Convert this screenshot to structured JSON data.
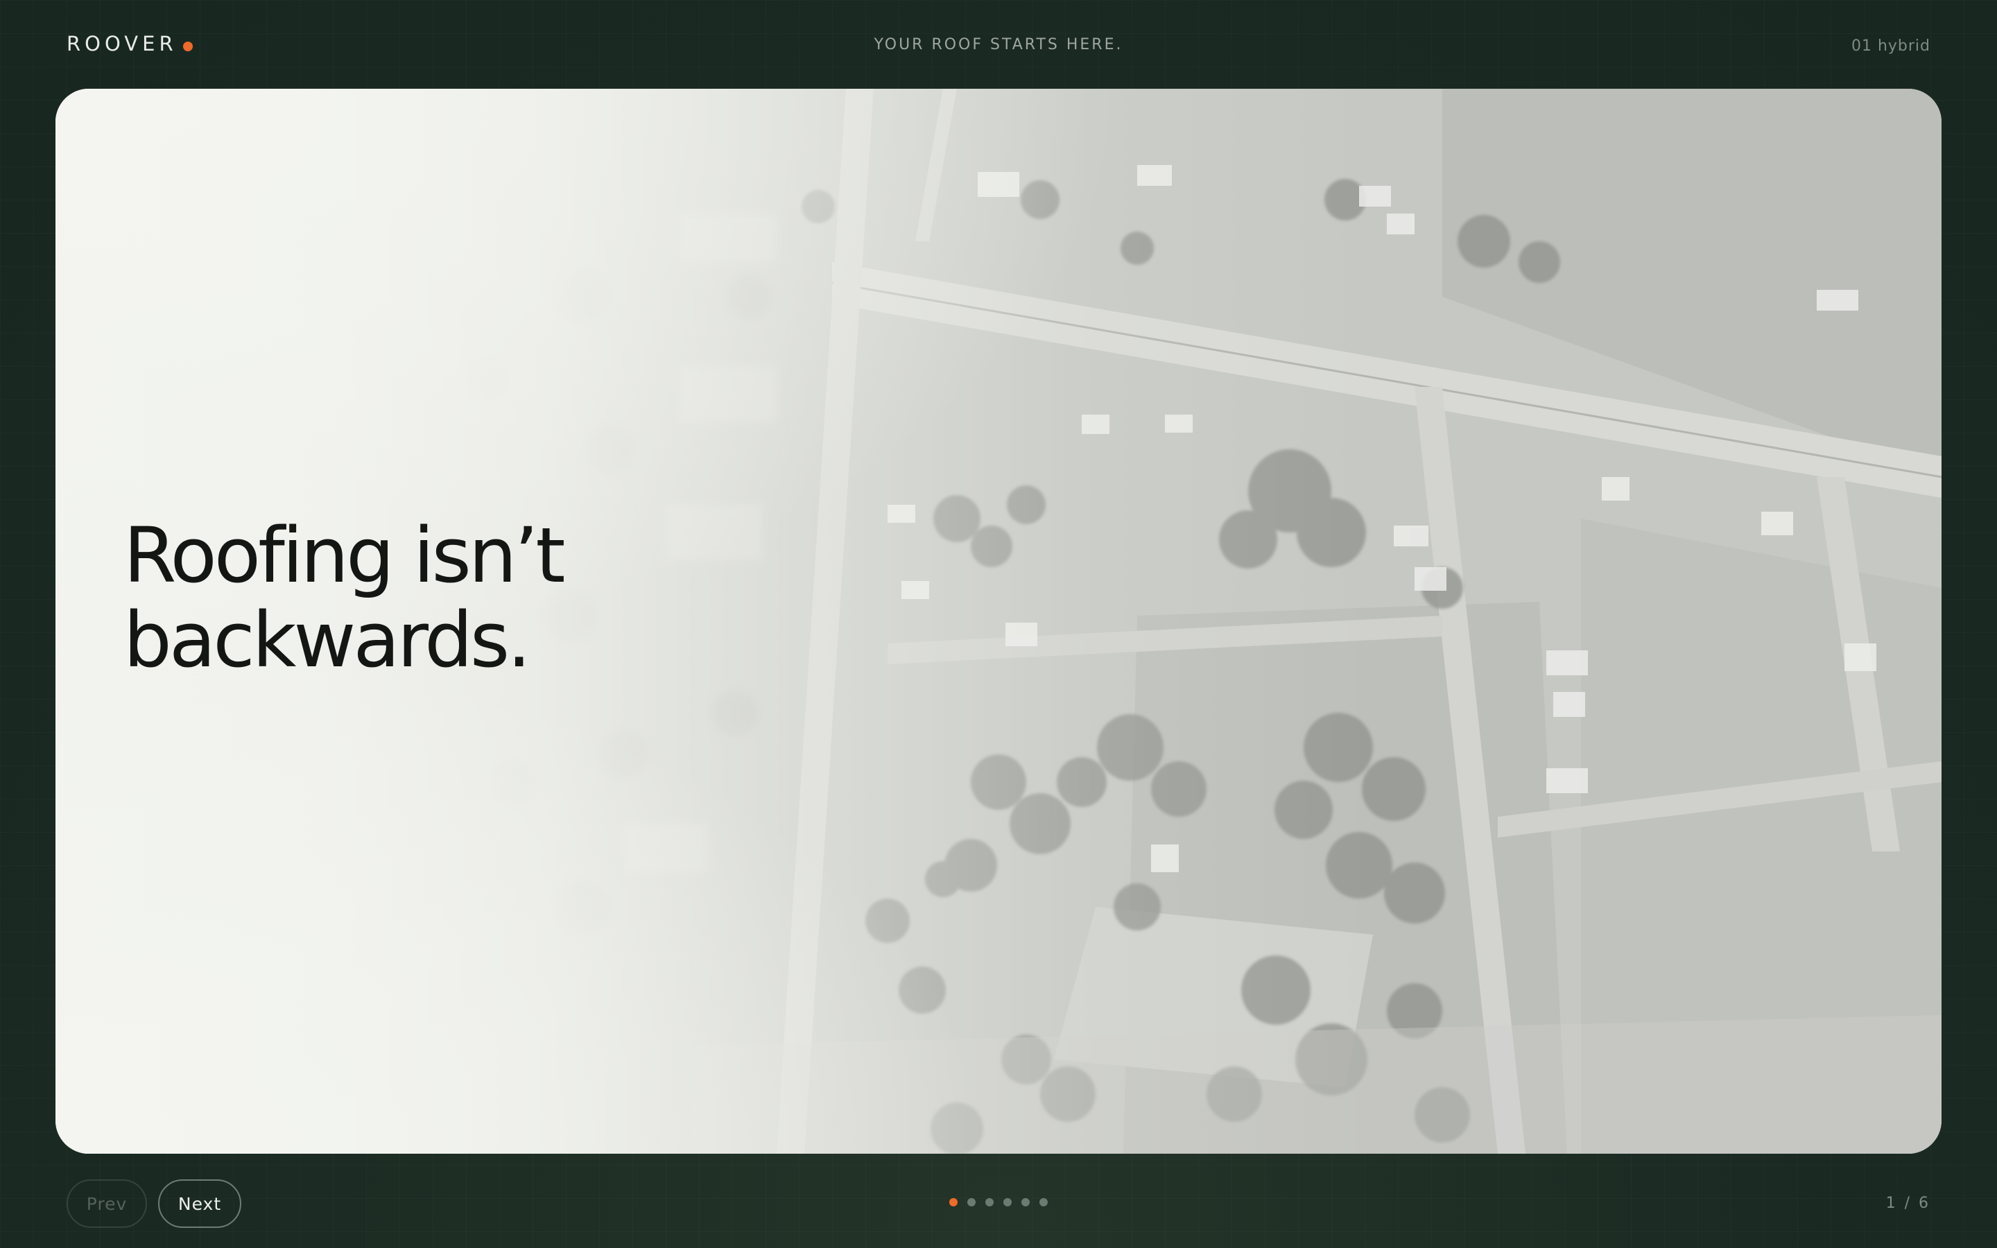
{
  "header": {
    "brand": "ROOVER",
    "tagline": "YOUR ROOF STARTS HERE.",
    "variant": "01 hybrid"
  },
  "slide": {
    "headline_line1": "Roofing isn’t",
    "headline_line2": "backwards."
  },
  "footer": {
    "prev_label": "Prev",
    "next_label": "Next",
    "counter": "1 / 6",
    "total_slides": 6,
    "active_slide": 1
  },
  "colors": {
    "background": "#1c2c25",
    "accent": "#f06a2a",
    "headline": "#141614"
  }
}
